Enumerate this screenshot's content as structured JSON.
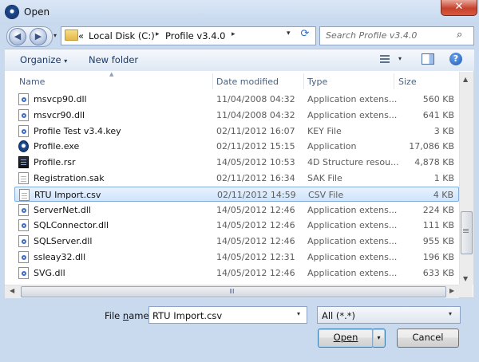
{
  "window": {
    "title": "Open",
    "close_glyph": "✕"
  },
  "address": {
    "overflow": "«",
    "segments": [
      "Local Disk (C:)",
      "Profile v3.4.0"
    ],
    "separator": "▸",
    "refresh_glyph": "⟳"
  },
  "search": {
    "placeholder": "Search Profile v3.4.0",
    "icon": "search-icon"
  },
  "toolbar": {
    "organize_label": "Organize",
    "new_folder_label": "New folder",
    "caret": "▾",
    "help_glyph": "?"
  },
  "columns": [
    "Name",
    "Date modified",
    "Type",
    "Size"
  ],
  "files": [
    {
      "name": "msvcp90.dll",
      "date": "11/04/2008 04:32",
      "type": "Application extens...",
      "size": "560 KB",
      "icon": "dll"
    },
    {
      "name": "msvcr90.dll",
      "date": "11/04/2008 04:32",
      "type": "Application extens...",
      "size": "641 KB",
      "icon": "dll"
    },
    {
      "name": "Profile Test v3.4.key",
      "date": "02/11/2012 16:07",
      "type": "KEY File",
      "size": "3 KB",
      "icon": "dll"
    },
    {
      "name": "Profile.exe",
      "date": "02/11/2012 15:15",
      "type": "Application",
      "size": "17,086 KB",
      "icon": "exe"
    },
    {
      "name": "Profile.rsr",
      "date": "14/05/2012 10:53",
      "type": "4D Structure resou...",
      "size": "4,878 KB",
      "icon": "rsr"
    },
    {
      "name": "Registration.sak",
      "date": "02/11/2012 16:34",
      "type": "SAK File",
      "size": "1 KB",
      "icon": "doc"
    },
    {
      "name": "RTU Import.csv",
      "date": "02/11/2012 14:59",
      "type": "CSV File",
      "size": "4 KB",
      "icon": "doc",
      "selected": true
    },
    {
      "name": "ServerNet.dll",
      "date": "14/05/2012 12:46",
      "type": "Application extens...",
      "size": "224 KB",
      "icon": "dll"
    },
    {
      "name": "SQLConnector.dll",
      "date": "14/05/2012 12:46",
      "type": "Application extens...",
      "size": "111 KB",
      "icon": "dll"
    },
    {
      "name": "SQLServer.dll",
      "date": "14/05/2012 12:46",
      "type": "Application extens...",
      "size": "955 KB",
      "icon": "dll"
    },
    {
      "name": "ssleay32.dll",
      "date": "14/05/2012 12:31",
      "type": "Application extens...",
      "size": "196 KB",
      "icon": "dll"
    },
    {
      "name": "SVG.dll",
      "date": "14/05/2012 12:46",
      "type": "Application extens...",
      "size": "633 KB",
      "icon": "dll"
    }
  ],
  "scroll": {
    "up": "▲",
    "down": "▼",
    "left": "◀",
    "right": "▶"
  },
  "filename": {
    "label": "File name:",
    "value": "RTU Import.csv",
    "caret": "▾"
  },
  "filetype": {
    "value": "All (*.*)",
    "caret": "▾"
  },
  "buttons": {
    "open_label": "Open",
    "split_caret": "▾",
    "cancel_label": "Cancel"
  }
}
